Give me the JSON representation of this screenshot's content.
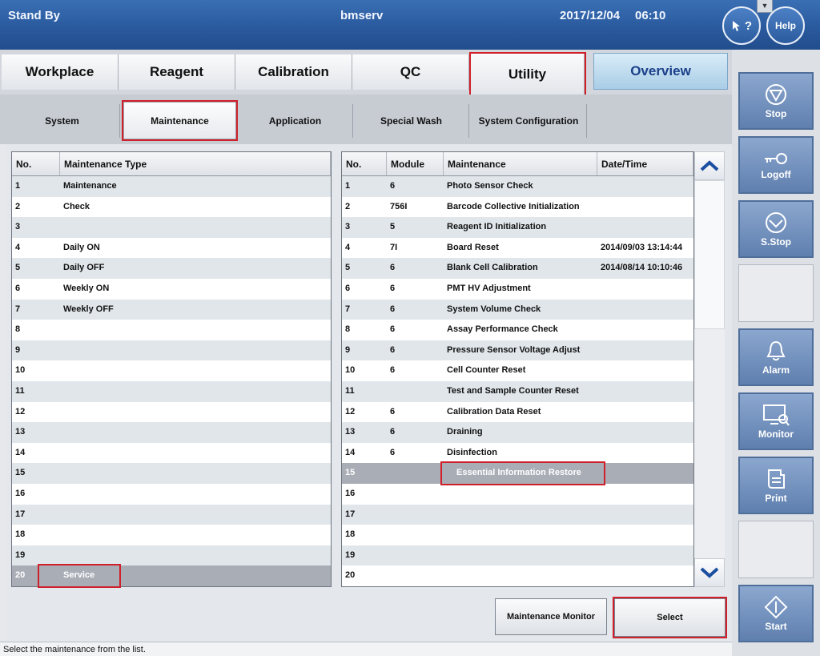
{
  "header": {
    "status": "Stand By",
    "user": "bmserv",
    "date": "2017/12/04",
    "time": "06:10",
    "help_q": "?",
    "help_label": "Help",
    "pull_tab": "▼"
  },
  "main_tabs": [
    {
      "label": "Workplace"
    },
    {
      "label": "Reagent"
    },
    {
      "label": "Calibration"
    },
    {
      "label": "QC"
    },
    {
      "label": "Utility"
    },
    {
      "label": "Overview"
    }
  ],
  "sub_tabs": [
    {
      "label": "System"
    },
    {
      "label": "Maintenance"
    },
    {
      "label": "Application"
    },
    {
      "label": "Special Wash"
    },
    {
      "label": "System Configuration"
    }
  ],
  "left_table": {
    "headers": [
      "No.",
      "Maintenance Type"
    ],
    "rows": [
      [
        "1",
        "Maintenance"
      ],
      [
        "2",
        "Check"
      ],
      [
        "3",
        ""
      ],
      [
        "4",
        "Daily ON"
      ],
      [
        "5",
        "Daily OFF"
      ],
      [
        "6",
        "Weekly ON"
      ],
      [
        "7",
        "Weekly OFF"
      ],
      [
        "8",
        ""
      ],
      [
        "9",
        ""
      ],
      [
        "10",
        ""
      ],
      [
        "11",
        ""
      ],
      [
        "12",
        ""
      ],
      [
        "13",
        ""
      ],
      [
        "14",
        ""
      ],
      [
        "15",
        ""
      ],
      [
        "16",
        ""
      ],
      [
        "17",
        ""
      ],
      [
        "18",
        ""
      ],
      [
        "19",
        ""
      ],
      [
        "20",
        "Service"
      ]
    ]
  },
  "right_table": {
    "headers": [
      "No.",
      "Module",
      "Maintenance",
      "Date/Time"
    ],
    "rows": [
      [
        "1",
        "6",
        "Photo Sensor Check",
        ""
      ],
      [
        "2",
        "756I",
        "Barcode Collective Initialization",
        ""
      ],
      [
        "3",
        "5",
        "Reagent ID Initialization",
        ""
      ],
      [
        "4",
        "7I",
        "Board Reset",
        "2014/09/03 13:14:44"
      ],
      [
        "5",
        "6",
        "Blank Cell Calibration",
        "2014/08/14 10:10:46"
      ],
      [
        "6",
        "6",
        "PMT HV Adjustment",
        ""
      ],
      [
        "7",
        "6",
        "System Volume Check",
        ""
      ],
      [
        "8",
        "6",
        "Assay Performance Check",
        ""
      ],
      [
        "9",
        "6",
        "Pressure Sensor Voltage Adjust",
        ""
      ],
      [
        "10",
        "6",
        "Cell Counter Reset",
        ""
      ],
      [
        "11",
        "",
        "Test and Sample Counter Reset",
        ""
      ],
      [
        "12",
        "6",
        "Calibration Data Reset",
        ""
      ],
      [
        "13",
        "6",
        "Draining",
        ""
      ],
      [
        "14",
        "6",
        "Disinfection",
        ""
      ],
      [
        "15",
        "",
        "Essential Information Restore",
        ""
      ],
      [
        "16",
        "",
        "",
        ""
      ],
      [
        "17",
        "",
        "",
        ""
      ],
      [
        "18",
        "",
        "",
        ""
      ],
      [
        "19",
        "",
        "",
        ""
      ],
      [
        "20",
        "",
        "",
        ""
      ]
    ]
  },
  "buttons": {
    "monitor": "Maintenance Monitor",
    "select": "Select"
  },
  "status_bar": "Select the maintenance from the list.",
  "sidebar": {
    "stop": "Stop",
    "logoff": "Logoff",
    "sstop": "S.Stop",
    "alarm": "Alarm",
    "monitor": "Monitor",
    "print": "Print",
    "start": "Start"
  },
  "icons": {
    "stop": "stop-icon",
    "logoff": "key-icon",
    "sstop": "sampling-stop-icon",
    "alarm": "bell-icon",
    "monitor": "monitor-icon",
    "print": "print-icon",
    "start": "start-icon"
  },
  "colors": {
    "header": "#2a5a9e",
    "highlight": "#d0202a",
    "selected_row": "#a9adb6",
    "sidebar_button": "#6f8fbd"
  }
}
